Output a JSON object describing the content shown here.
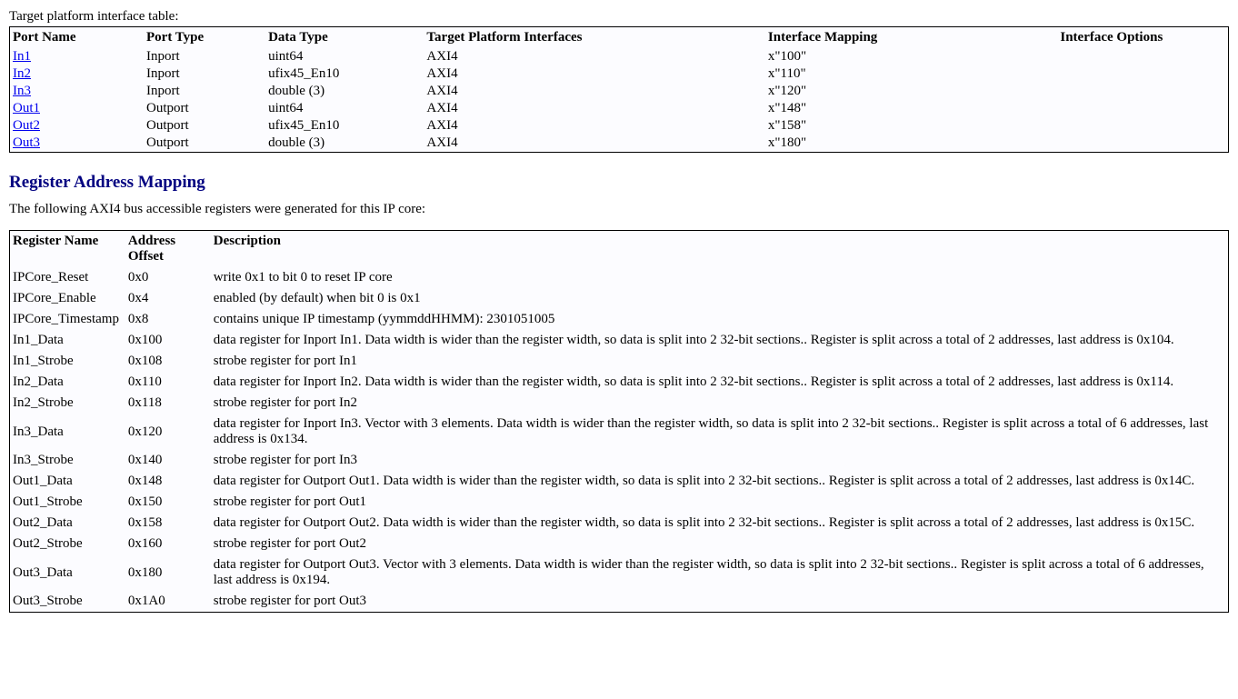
{
  "interfaceTable": {
    "label": "Target platform interface table:",
    "headers": [
      "Port Name",
      "Port Type",
      "Data Type",
      "Target Platform Interfaces",
      "Interface Mapping",
      "Interface Options"
    ],
    "rows": [
      {
        "port": "In1",
        "type": "Inport",
        "data": "uint64",
        "iface": "AXI4",
        "map": "x\"100\"",
        "opts": ""
      },
      {
        "port": "In2",
        "type": "Inport",
        "data": "ufix45_En10",
        "iface": "AXI4",
        "map": "x\"110\"",
        "opts": ""
      },
      {
        "port": "In3",
        "type": "Inport",
        "data": "double (3)",
        "iface": "AXI4",
        "map": "x\"120\"",
        "opts": ""
      },
      {
        "port": "Out1",
        "type": "Outport",
        "data": "uint64",
        "iface": "AXI4",
        "map": "x\"148\"",
        "opts": ""
      },
      {
        "port": "Out2",
        "type": "Outport",
        "data": "ufix45_En10",
        "iface": "AXI4",
        "map": "x\"158\"",
        "opts": ""
      },
      {
        "port": "Out3",
        "type": "Outport",
        "data": "double (3)",
        "iface": "AXI4",
        "map": "x\"180\"",
        "opts": ""
      }
    ]
  },
  "section": {
    "title": "Register Address Mapping",
    "intro": "The following AXI4 bus accessible registers were generated for this IP core:"
  },
  "registerTable": {
    "headers": [
      "Register Name",
      "Address Offset",
      "Description"
    ],
    "rows": [
      {
        "name": "IPCore_Reset",
        "addr": "0x0",
        "desc": "write 0x1 to bit 0 to reset IP core"
      },
      {
        "name": "IPCore_Enable",
        "addr": "0x4",
        "desc": "enabled (by default) when bit 0 is 0x1"
      },
      {
        "name": "IPCore_Timestamp",
        "addr": "0x8",
        "desc": "contains unique IP timestamp (yymmddHHMM): 2301051005"
      },
      {
        "name": "In1_Data",
        "addr": "0x100",
        "desc": "data register for Inport In1. Data width is wider than the register width, so data is split into 2 32-bit sections.. Register is split across a total of 2 addresses, last address is 0x104."
      },
      {
        "name": "In1_Strobe",
        "addr": "0x108",
        "desc": "strobe register for port In1"
      },
      {
        "name": "In2_Data",
        "addr": "0x110",
        "desc": "data register for Inport In2. Data width is wider than the register width, so data is split into 2 32-bit sections.. Register is split across a total of 2 addresses, last address is 0x114."
      },
      {
        "name": "In2_Strobe",
        "addr": "0x118",
        "desc": "strobe register for port In2"
      },
      {
        "name": "In3_Data",
        "addr": "0x120",
        "desc": "data register for Inport In3. Vector with 3 elements. Data width is wider than the register width, so data is split into 2 32-bit sections.. Register is split across a total of 6 addresses, last address is 0x134."
      },
      {
        "name": "In3_Strobe",
        "addr": "0x140",
        "desc": "strobe register for port In3"
      },
      {
        "name": "Out1_Data",
        "addr": "0x148",
        "desc": "data register for Outport Out1. Data width is wider than the register width, so data is split into 2 32-bit sections.. Register is split across a total of 2 addresses, last address is 0x14C."
      },
      {
        "name": "Out1_Strobe",
        "addr": "0x150",
        "desc": "strobe register for port Out1"
      },
      {
        "name": "Out2_Data",
        "addr": "0x158",
        "desc": "data register for Outport Out2. Data width is wider than the register width, so data is split into 2 32-bit sections.. Register is split across a total of 2 addresses, last address is 0x15C."
      },
      {
        "name": "Out2_Strobe",
        "addr": "0x160",
        "desc": "strobe register for port Out2"
      },
      {
        "name": "Out3_Data",
        "addr": "0x180",
        "desc": "data register for Outport Out3. Vector with 3 elements. Data width is wider than the register width, so data is split into 2 32-bit sections.. Register is split across a total of 6 addresses, last address is 0x194."
      },
      {
        "name": "Out3_Strobe",
        "addr": "0x1A0",
        "desc": "strobe register for port Out3"
      }
    ]
  }
}
